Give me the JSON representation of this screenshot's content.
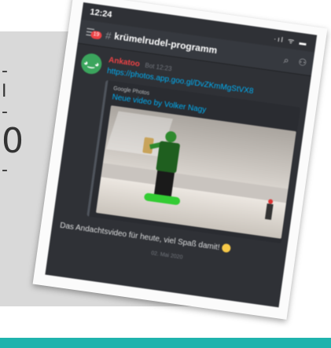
{
  "phone": {
    "time": "12:24",
    "status_icons": "·ıl ᯤ ▬",
    "unread_badge": "19",
    "channel_hash": "#",
    "channel_name": "krümelrudel-programm"
  },
  "message": {
    "author": "Ankatoo",
    "timestamp": "Bot 12:23",
    "avatar_icon": "discord-logo",
    "link": "https://photos.app.goo.gl/DvZKmMgStVX8",
    "embed_provider": "Google Photos",
    "embed_title": "Neue video by Volker Nagy",
    "caption": "Das Andachtsvideo für heute, viel Spaß damit!",
    "date": "02. Mai 2020"
  },
  "page_edge": {
    "glyphs": [
      "-",
      "I",
      "-",
      "0",
      "-"
    ]
  },
  "colors": {
    "accent_teal": "#1fb3ad",
    "discord_bg": "#2f3136",
    "link_blue": "#00aff4",
    "author_red": "#ed4245"
  }
}
